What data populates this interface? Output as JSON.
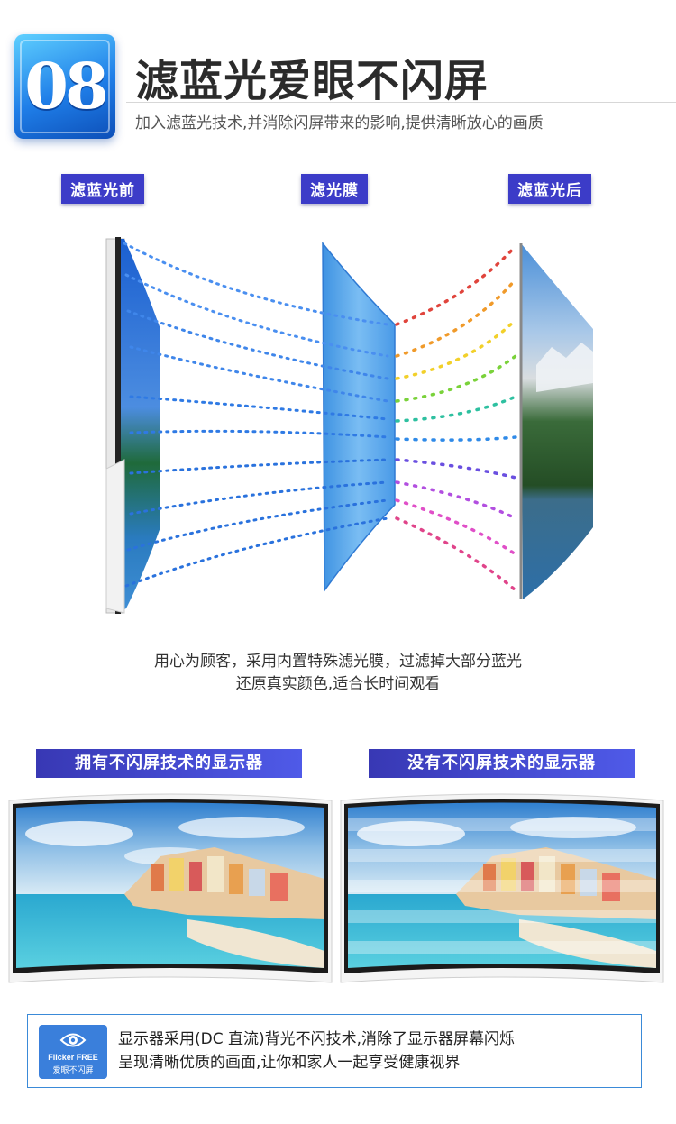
{
  "header": {
    "badge_number": "08",
    "title": "滤蓝光爱眼不闪屏",
    "subtitle": "加入滤蓝光技术,并消除闪屏带来的影响,提供清晰放心的画质"
  },
  "diagram": {
    "label_before": "滤蓝光前",
    "label_film": "滤光膜",
    "label_after": "滤蓝光后"
  },
  "description": {
    "line1": "用心为顾客，采用内置特殊滤光膜，过滤掉大部分蓝光",
    "line2": "还原真实颜色,适合长时间观看"
  },
  "comparison": {
    "label_with": "拥有不闪屏技术的显示器",
    "label_without": "没有不闪屏技术的显示器"
  },
  "info": {
    "icon_label_en": "Flicker FREE",
    "icon_label_cn": "爱眼不闪屏",
    "line1": "显示器采用(DC 直流)背光不闪技术,消除了显示器屏幕闪烁",
    "line2": "呈现清晰优质的画面,让你和家人一起享受健康视界"
  },
  "colors": {
    "accent_blue": "#3c3cc8",
    "badge_blue": "#1f7ee8"
  }
}
